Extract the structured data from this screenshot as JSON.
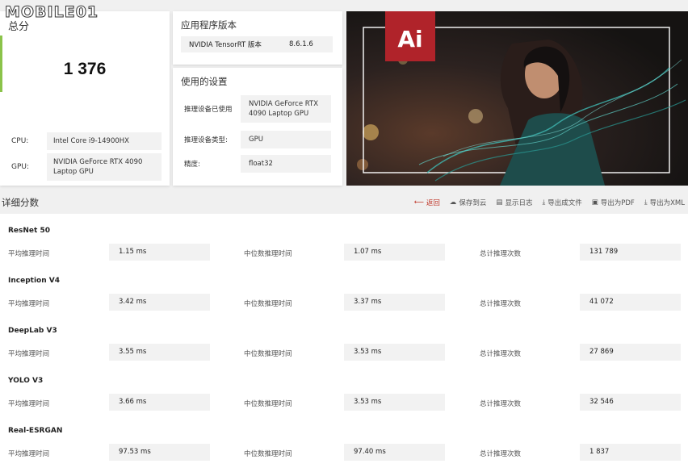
{
  "watermark": "MOBILE01",
  "score": {
    "title": "总分",
    "value": "1 376"
  },
  "hardware": [
    {
      "label": "CPU:",
      "value": "Intel Core i9-14900HX"
    },
    {
      "label": "GPU:",
      "value": "NVIDIA GeForce RTX 4090 Laptop GPU"
    }
  ],
  "version": {
    "title": "应用程序版本",
    "key": "NVIDIA TensorRT 版本",
    "value": "8.6.1.6"
  },
  "settings": {
    "title": "使用的设置",
    "rows": [
      {
        "key": "推理设备已使用",
        "value": "NVIDIA GeForce RTX 4090 Laptop GPU"
      },
      {
        "key": "推理设备类型:",
        "value": "GPU"
      },
      {
        "key": "精度:",
        "value": "float32"
      }
    ]
  },
  "banner": {
    "logo_text": "Ai",
    "accent_color": "#b0232a"
  },
  "details": {
    "title": "详细分数",
    "toolbar": [
      {
        "label": "返回",
        "icon": "back-arrow-icon"
      },
      {
        "label": "保存到云",
        "icon": "cloud-icon"
      },
      {
        "label": "显示日志",
        "icon": "document-icon"
      },
      {
        "label": "导出成文件",
        "icon": "download-icon"
      },
      {
        "label": "导出为PDF",
        "icon": "save-icon"
      },
      {
        "label": "导出为XML",
        "icon": "download-icon"
      }
    ],
    "labels": {
      "avg": "平均推理时间",
      "median": "中位数推理时间",
      "total": "总计推理次数"
    },
    "models": [
      {
        "name": "ResNet 50",
        "avg": "1.15 ms",
        "median": "1.07 ms",
        "total": "131 789"
      },
      {
        "name": "Inception V4",
        "avg": "3.42 ms",
        "median": "3.37 ms",
        "total": "41 072"
      },
      {
        "name": "DeepLab V3",
        "avg": "3.55 ms",
        "median": "3.53 ms",
        "total": "27 869"
      },
      {
        "name": "YOLO V3",
        "avg": "3.66 ms",
        "median": "3.53 ms",
        "total": "32 546"
      },
      {
        "name": "Real-ESRGAN",
        "avg": "97.53 ms",
        "median": "97.40 ms",
        "total": "1 837"
      }
    ]
  }
}
